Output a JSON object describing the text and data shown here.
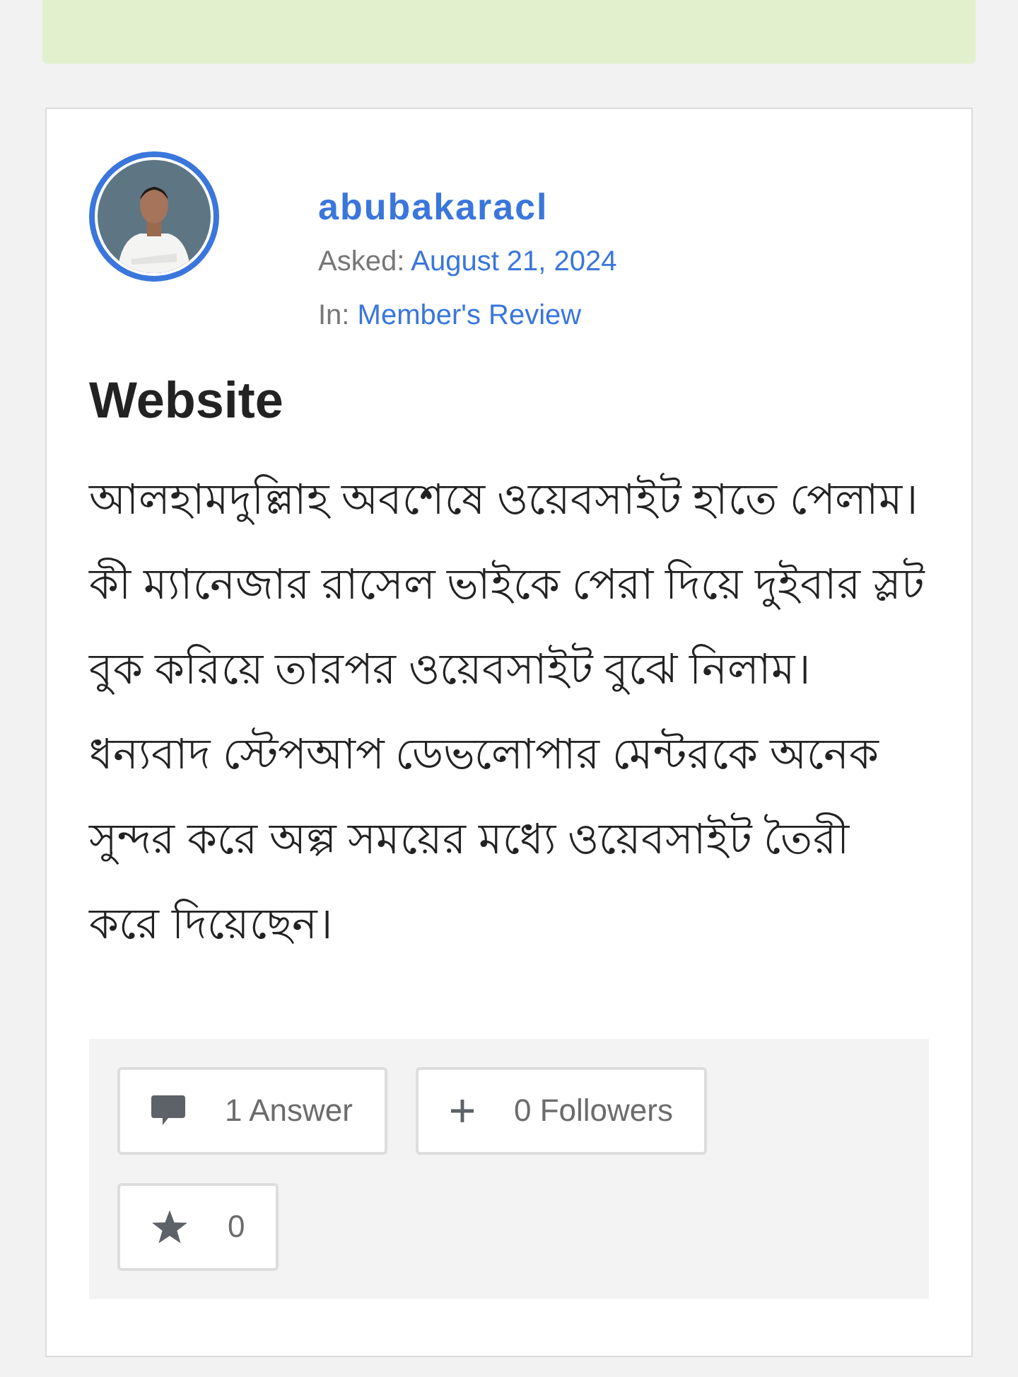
{
  "author": {
    "name": "abubakaracl"
  },
  "meta": [
    {
      "label": "Asked:",
      "value": "August 21, 2024"
    },
    {
      "label": "In:",
      "value": "Member's Review"
    }
  ],
  "question": {
    "title": "Website",
    "body": "আলহামদুল্লিাহ অবশেষে ওয়েবসাইট হাতে পেলাম। কী ম্যানেজার রাসেল ভাইকে পেরা দিয়ে দুইবার স্লট বুক করিয়ে তারপর ওয়েবসাইট বুঝে নিলাম। ধন্যবাদ স্টেপআপ ডেভলোপার মেন্টরকে অনেক সুন্দর করে অল্প সময়ের মধ্যে ওয়েবসাইট তৈরী করে দিয়েছেন।"
  },
  "stats": [
    {
      "kind": "answers",
      "count": "1",
      "label": "Answer"
    },
    {
      "kind": "followers",
      "count": "0",
      "label": "Followers"
    },
    {
      "kind": "favorites",
      "count": "0"
    }
  ]
}
